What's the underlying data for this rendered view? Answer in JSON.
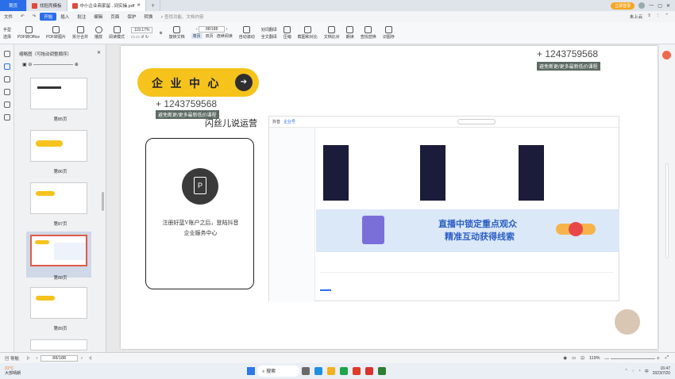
{
  "tabs": {
    "home": "首页",
    "tab1": "找稻壳模板",
    "tab2": "中小企业商家留...间实操.pdf"
  },
  "menu": {
    "file": "文件",
    "start": "开始",
    "insert": "插入",
    "annotate": "批注",
    "edit": "编辑",
    "page": "页面",
    "protect": "保护",
    "convert": "转换",
    "search_placeholder": "查找功能、文档内容",
    "share": "未上云",
    "user": "立即登录",
    "time_tr": "4"
  },
  "ribbon": {
    "hand": "手型",
    "select": "选择",
    "pdf_office": "PDF转Office",
    "pdf_img": "PDF转图片",
    "split": "拆分合并",
    "play": "播放",
    "read": "阅读模式",
    "zoom": "119.17%",
    "page_input": "88/188",
    "rotate": "旋转文档",
    "single": "单页",
    "double": "双页",
    "continuous": "连续阅读",
    "auto_scroll": "自动滚动",
    "translate": "划词翻译",
    "full_translate": "全文翻译",
    "compress": "压缩",
    "crop": "截图和对比",
    "compare": "文档比对",
    "read_aloud": "朗读",
    "find_replace": "查找替换",
    "screenshot": "识图存"
  },
  "thumbs": {
    "header": "缩略图（可拖动调整顺序）",
    "p85": "第85页",
    "p86": "第86页",
    "p87": "第87页",
    "p88": "第88页",
    "p89": "第89页"
  },
  "slide": {
    "title": "企 业 中 心",
    "watermark_num": "+ 1243759568",
    "watermark_tag": "避免断更/更多最新低价课程",
    "overlay": "闪丝儿说运营",
    "card_text": "注册好蓝V账户之后，登陆抖音企业服务中心",
    "banner_line1": "直播中锁定重点观众",
    "banner_line2": "精准互动获得线索",
    "shot_app": "抖音",
    "shot_section": "企业号"
  },
  "status": {
    "nav": "导航",
    "page": "88/188",
    "zoom": "119%"
  },
  "taskbar": {
    "weather": "31°C",
    "weather_desc": "大部晴朗",
    "search": "搜索",
    "time": "16:47",
    "date": "2023/7/20"
  },
  "colors": {
    "accent": "#2b6fe8",
    "pill": "#f5c31c",
    "dark": "#2f2f2f"
  }
}
